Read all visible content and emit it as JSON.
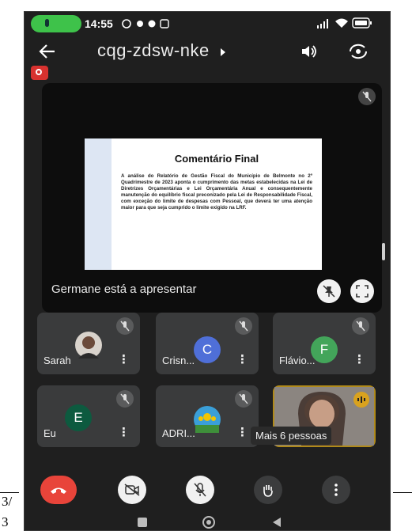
{
  "page": {
    "edge_text_top": "3/",
    "edge_text_bottom": "3"
  },
  "status_bar": {
    "time": "14:55"
  },
  "header": {
    "meeting_code": "cqg-zdsw-nke"
  },
  "slide": {
    "title": "Comentário Final",
    "body": "A análise do Relatório de Gestão Fiscal do Município de Belmonte no 2º Quadrimestre de 2023 aponta o cumprimento das metas estabelecidas na Lei de Diretrizes Orçamentárias e Lei Orçamentária Anual e consequentemente manutenção do equilíbrio fiscal preconizado pela Lei de Responsabilidade Fiscal, com exceção do limite de despesas com Pessoal, que deverá ter uma atenção maior para que seja cumprido o limite exigido na LRF."
  },
  "presentation": {
    "presenter_label": "Germane está a apresentar"
  },
  "participants": [
    {
      "name": "Sarah"
    },
    {
      "name": "Crisn...",
      "initial": "C"
    },
    {
      "name": "Flávio...",
      "initial": "F"
    },
    {
      "name": "Eu",
      "initial": "E"
    },
    {
      "name": "ADRI..."
    },
    {
      "name": "Mais 6 pessoas"
    }
  ],
  "colors": {
    "avatar_c": "#4f6fd8",
    "avatar_f": "#43a55a",
    "avatar_e": "#0d5a3f",
    "end_call": "#e8443a",
    "more_tile_border": "#b08a1a"
  }
}
